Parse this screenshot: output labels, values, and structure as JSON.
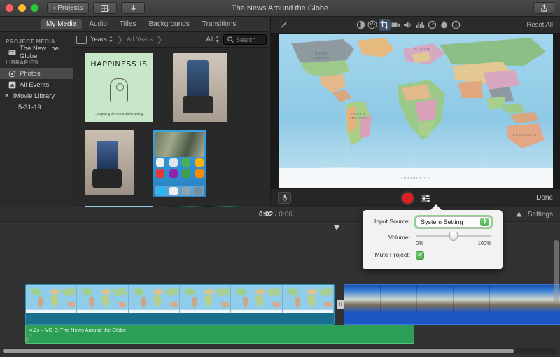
{
  "window": {
    "title": "The News Around the Globe",
    "back_button": "Projects",
    "share_icon": "share-icon",
    "layout_icon": "layout-icon",
    "import_icon": "import-download-icon"
  },
  "tabs": [
    {
      "label": "My Media",
      "active": true
    },
    {
      "label": "Audio",
      "active": false
    },
    {
      "label": "Titles",
      "active": false
    },
    {
      "label": "Backgrounds",
      "active": false
    },
    {
      "label": "Transitions",
      "active": false
    }
  ],
  "filterbar": {
    "sidebar_toggle_icon": "sidebar-toggle-icon",
    "group_by": "Years",
    "breadcrumb": "All Years",
    "filter": "All",
    "search_icon": "search-icon",
    "search_placeholder": "Search",
    "search_value": ""
  },
  "sidebar": {
    "project_media_header": "PROJECT MEDIA",
    "project_item": {
      "label": "The New...he Globe",
      "icon": "movie-clip-icon"
    },
    "libraries_header": "LIBRARIES",
    "items": [
      {
        "label": "Photos",
        "icon": "photos-icon",
        "selected": true
      },
      {
        "label": "All Events",
        "icon": "events-icon",
        "selected": false
      },
      {
        "label": "iMovie Library",
        "icon": "disclosure-triangle-icon",
        "selected": false
      },
      {
        "label": "5-31-19",
        "icon": "event-icon",
        "selected": false
      }
    ]
  },
  "browser": {
    "thumbnails": [
      {
        "name": "happiness-is-card",
        "title": "HAPPINESS IS",
        "caption": "...forgetting the world whilst writing."
      },
      {
        "name": "trolley-photo",
        "title": "",
        "caption": ""
      },
      {
        "name": "trolley-photo-2",
        "title": "",
        "caption": ""
      },
      {
        "name": "ipad-screenshot",
        "title": "",
        "caption": ""
      },
      {
        "name": "world-map-clip",
        "title": "",
        "caption": ""
      },
      {
        "name": "dark-teal-clip",
        "title": "",
        "caption": ""
      }
    ]
  },
  "viewer": {
    "tools": [
      {
        "name": "enhance-wand-icon",
        "glyph": "✨",
        "selected": false
      },
      {
        "name": "color-balance-icon",
        "glyph": "◐",
        "selected": false
      },
      {
        "name": "color-correction-icon",
        "glyph": "🎨",
        "selected": false
      },
      {
        "name": "crop-icon",
        "glyph": "⛶",
        "selected": true
      },
      {
        "name": "stabilization-icon",
        "glyph": "🎥",
        "selected": false
      },
      {
        "name": "volume-icon",
        "glyph": "🔊",
        "selected": false
      },
      {
        "name": "noise-reduction-icon",
        "glyph": "📊",
        "selected": false
      },
      {
        "name": "speed-icon",
        "glyph": "⏱",
        "selected": false
      },
      {
        "name": "clip-filter-icon",
        "glyph": "⬤",
        "selected": false
      },
      {
        "name": "info-icon",
        "glyph": "ⓘ",
        "selected": false
      }
    ],
    "reset_all": "Reset All",
    "preview_image": "world-political-map",
    "mic_icon": "microphone-icon",
    "record_icon": "record-button",
    "record_settings_icon": "record-settings-icon",
    "done_label": "Done"
  },
  "popover": {
    "input_source_label": "Input Source:",
    "input_source_value": "System Setting",
    "volume_label": "Volume:",
    "volume_min": "0%",
    "volume_max": "100%",
    "volume_percent": 50,
    "mute_label": "Mute Project:",
    "mute_checked": true,
    "check_glyph": "✔"
  },
  "timeline": {
    "current_time": "0:02",
    "separator": "/",
    "total_time": "0:06",
    "settings_label": "Settings",
    "adjust_icon": "adjust-icon",
    "music_icon": "music-note-icon",
    "clips": [
      {
        "name": "video-clip-world-map",
        "label": ""
      },
      {
        "name": "video-clip-blue",
        "label": ""
      }
    ],
    "audio_clip_label": "4.2s – VO-3: The News Around the Globe",
    "trim_handle_icon": "trim-handle-icon"
  },
  "colors": {
    "accent_green": "#2d9e55",
    "record_red": "#e02020",
    "selection_blue": "#3d4f63",
    "clip_blue": "#1b56c4"
  }
}
